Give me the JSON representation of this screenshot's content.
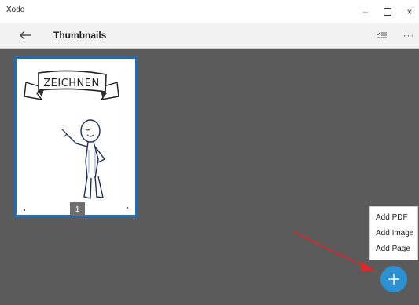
{
  "window": {
    "title": "Xodo",
    "minimize_glyph": "–",
    "close_glyph": "×"
  },
  "toolbar": {
    "back_icon": "back-arrow-icon",
    "title": "Thumbnails",
    "select_icon": "select-list-icon",
    "more_icon": "more-icon",
    "more_glyph": "···"
  },
  "thumbnails": [
    {
      "page_number": "1",
      "banner_text": "ZEICHNEN",
      "selected": true
    }
  ],
  "add_menu": {
    "items": [
      {
        "label": "Add PDF"
      },
      {
        "label": "Add Image"
      },
      {
        "label": "Add Page"
      }
    ]
  },
  "fab": {
    "icon": "plus-icon"
  },
  "colors": {
    "content_bg": "#5b5b5b",
    "selection_border": "#2d6aa3",
    "fab": "#2d90d0",
    "annotation_arrow": "#e0262a"
  }
}
